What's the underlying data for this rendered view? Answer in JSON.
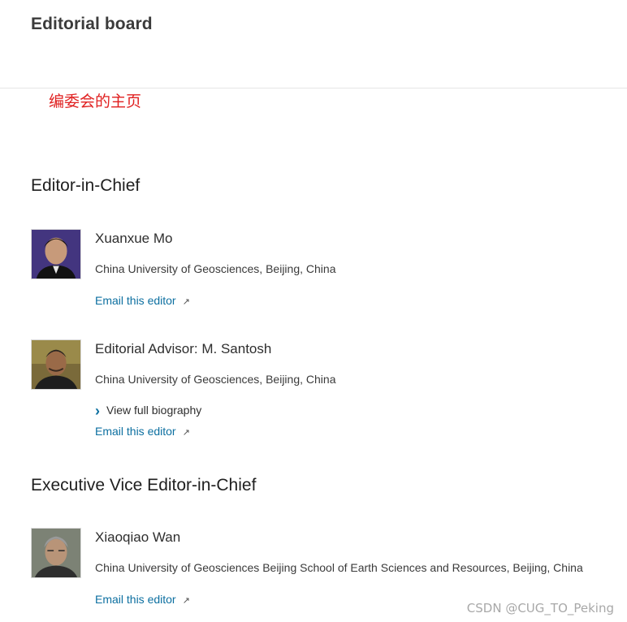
{
  "page": {
    "title": "Editorial board",
    "annotation": "编委会的主页"
  },
  "sections": [
    {
      "heading": "Editor-in-Chief",
      "editors": [
        {
          "name": "Xuanxue Mo",
          "affiliation": "China University of Geosciences, Beijing, China",
          "email_label": "Email this editor",
          "email_icon": "external-arrow-icon"
        },
        {
          "name": "Editorial Advisor: M. Santosh",
          "affiliation": "China University of Geosciences, Beijing, China",
          "bio_label": "View full biography",
          "bio_icon": "chevron-right-icon",
          "email_label": "Email this editor",
          "email_icon": "external-arrow-icon"
        }
      ]
    },
    {
      "heading": "Executive Vice Editor-in-Chief",
      "editors": [
        {
          "name": "Xiaoqiao Wan",
          "affiliation": "China University of Geosciences Beijing School of Earth Sciences and Resources, Beijing, China",
          "email_label": "Email this editor",
          "email_icon": "external-arrow-icon"
        }
      ]
    }
  ],
  "watermark": "CSDN @CUG_TO_Peking",
  "colors": {
    "link": "#0c6fa0",
    "annotation": "#e02020"
  }
}
